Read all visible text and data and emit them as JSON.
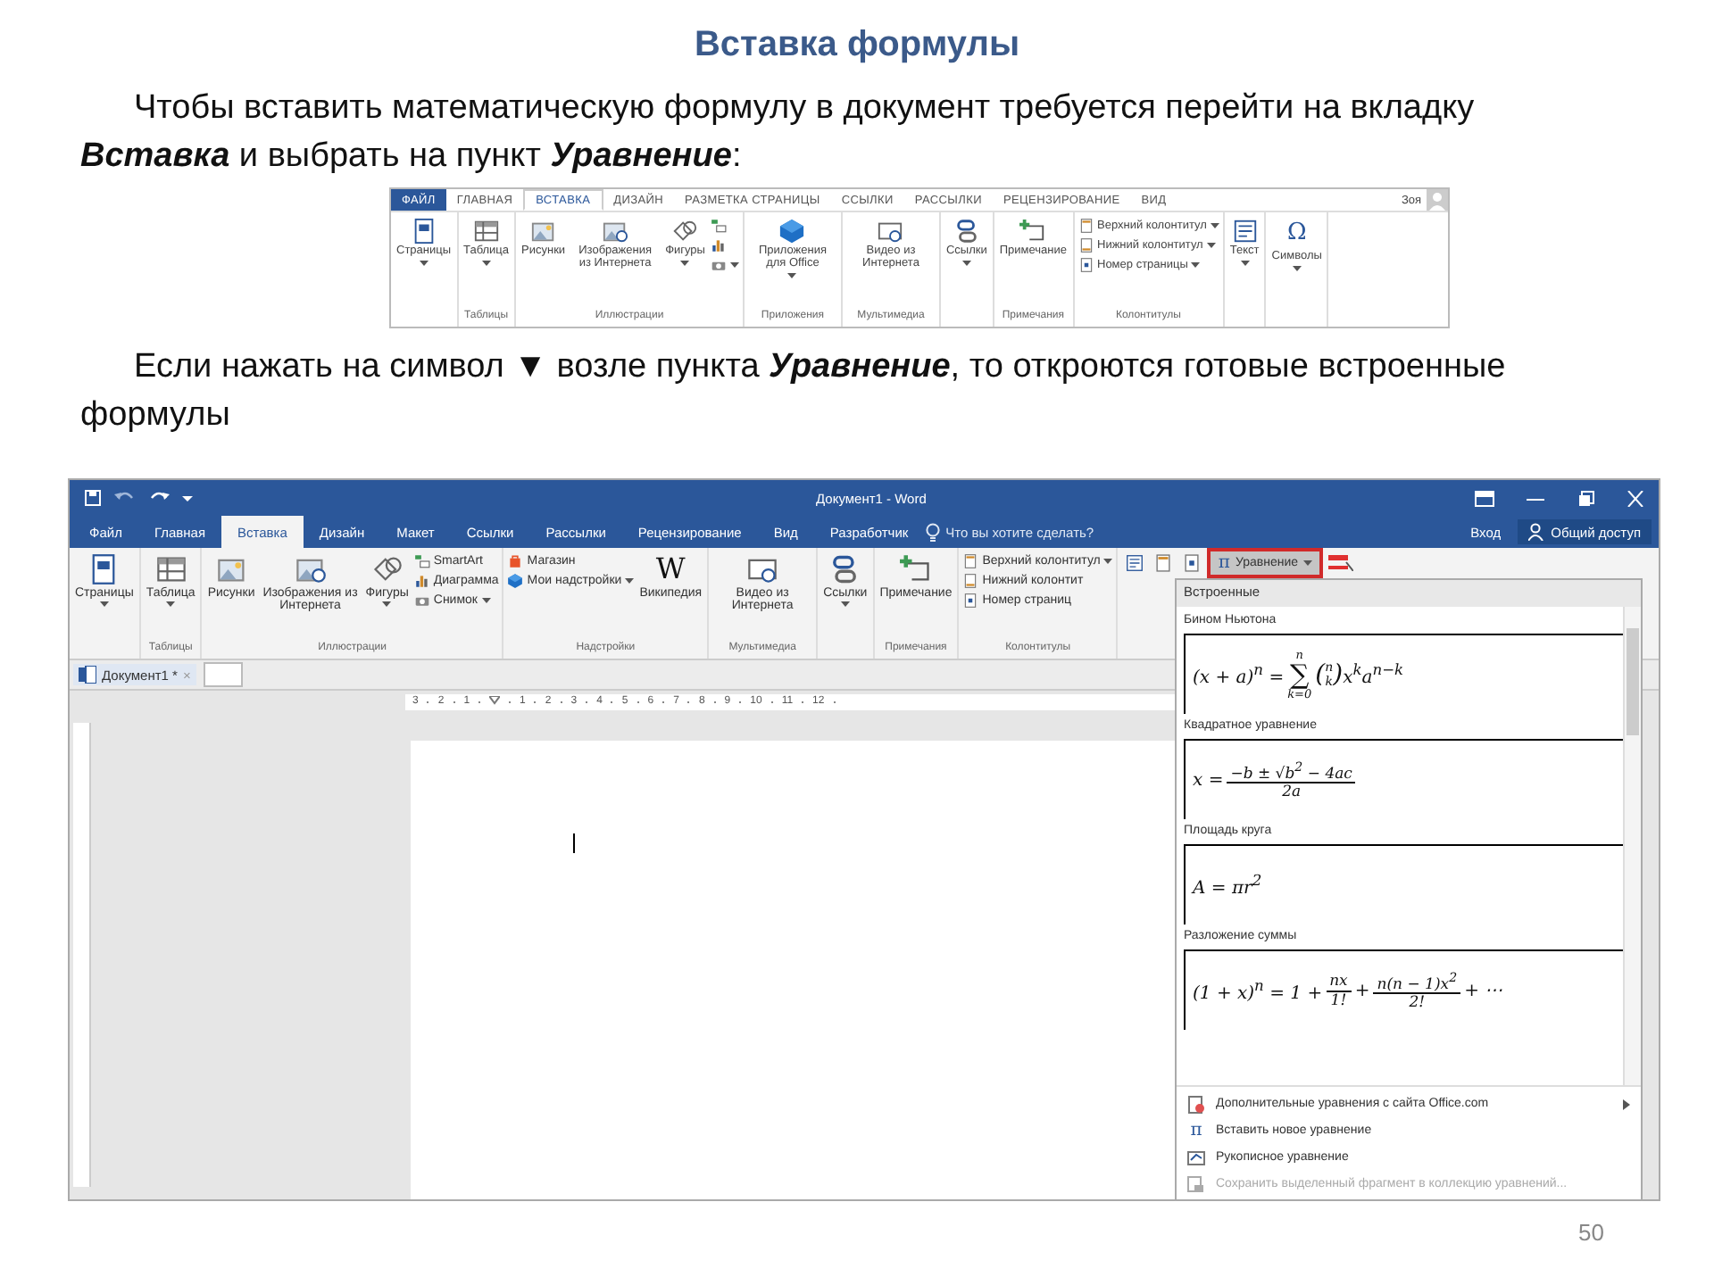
{
  "slide": {
    "title": "Вставка формулы",
    "paragraphs": [
      "Чтобы вставить математическую формулу в документ требуется перейти на вкладку **Вставка** и выбрать на пункт **Уравнение**:",
      "Если нажать на символ ▼ возле пункта **Уравнение**, то откроются готовые встроенные формулы"
    ],
    "page_number": "50"
  },
  "ribbon_screenshot": {
    "tabs": [
      {
        "label": "ФАЙЛ",
        "kind": "file",
        "selected": false
      },
      {
        "label": "ГЛАВНАЯ",
        "kind": "tab",
        "selected": false
      },
      {
        "label": "ВСТАВКА",
        "kind": "tab",
        "selected": true
      },
      {
        "label": "ДИЗАЙН",
        "kind": "tab",
        "selected": false
      },
      {
        "label": "РАЗМЕТКА СТРАНИЦЫ",
        "kind": "tab",
        "selected": false
      },
      {
        "label": "ССЫЛКИ",
        "kind": "tab",
        "selected": false
      },
      {
        "label": "РАССЫЛКИ",
        "kind": "tab",
        "selected": false
      },
      {
        "label": "РЕЦЕНЗИРОВАНИЕ",
        "kind": "tab",
        "selected": false
      },
      {
        "label": "ВИД",
        "kind": "tab",
        "selected": false
      }
    ],
    "user": "Зоя",
    "groups": [
      {
        "buttons": [
          {
            "label": "Страницы",
            "kind": "large",
            "menu": true
          }
        ]
      },
      {
        "label": "Таблицы",
        "buttons": [
          {
            "label": "Таблица",
            "kind": "large",
            "menu": true
          }
        ]
      },
      {
        "label": "Иллюстрации",
        "buttons": [
          {
            "label": "Рисунки",
            "kind": "large",
            "menu": false
          },
          {
            "label": "Изображения из Интернета",
            "kind": "large",
            "menu": false
          },
          {
            "label": "Фигуры",
            "kind": "large",
            "menu": true
          },
          {
            "kind": "icon",
            "menu": false
          },
          {
            "kind": "icon",
            "menu": false
          },
          {
            "kind": "icon",
            "menu": true
          }
        ]
      },
      {
        "label": "Приложения",
        "buttons": [
          {
            "label": "Приложения для Office",
            "kind": "large",
            "menu": true
          }
        ]
      },
      {
        "label": "Мультимедиа",
        "buttons": [
          {
            "label": "Видео из Интернета",
            "kind": "large",
            "menu": false
          }
        ]
      },
      {
        "buttons": [
          {
            "label": "Ссылки",
            "kind": "large",
            "menu": true
          }
        ]
      },
      {
        "label": "Примечания",
        "buttons": [
          {
            "label": "Примечание",
            "kind": "large",
            "menu": false
          }
        ]
      },
      {
        "label": "Колонтитулы",
        "buttons": [
          {
            "label": "Верхний колонтитул",
            "kind": "small",
            "menu": true
          },
          {
            "label": "Нижний колонтитул",
            "kind": "small",
            "menu": true
          },
          {
            "label": "Номер страницы",
            "kind": "small",
            "menu": true
          }
        ]
      },
      {
        "buttons": [
          {
            "label": "Текст",
            "kind": "large",
            "menu": true
          }
        ]
      },
      {
        "buttons": [
          {
            "label": "Символы",
            "kind": "large",
            "menu": true,
            "glyph": "Ω"
          }
        ]
      }
    ]
  },
  "word_window": {
    "title": "Документ1 - Word",
    "tabs": [
      {
        "label": "Файл",
        "selected": false
      },
      {
        "label": "Главная",
        "selected": false
      },
      {
        "label": "Вставка",
        "selected": true
      },
      {
        "label": "Дизайн",
        "selected": false
      },
      {
        "label": "Макет",
        "selected": false
      },
      {
        "label": "Ссылки",
        "selected": false
      },
      {
        "label": "Рассылки",
        "selected": false
      },
      {
        "label": "Рецензирование",
        "selected": false
      },
      {
        "label": "Вид",
        "selected": false
      },
      {
        "label": "Разработчик",
        "selected": false
      }
    ],
    "tell_me": "Что вы хотите сделать?",
    "sign_in": "Вход",
    "share": "Общий доступ",
    "groups": [
      {
        "buttons": [
          {
            "label": "Страницы",
            "kind": "large",
            "menu": true
          }
        ]
      },
      {
        "label": "Таблицы",
        "buttons": [
          {
            "label": "Таблица",
            "kind": "large",
            "menu": true
          }
        ]
      },
      {
        "label": "Иллюстрации",
        "buttons": [
          {
            "label": "Рисунки",
            "kind": "large",
            "menu": false
          },
          {
            "label": "Изображения из Интернета",
            "kind": "large",
            "menu": false
          },
          {
            "label": "Фигуры",
            "kind": "large",
            "menu": true
          },
          {
            "label": "SmartArt",
            "kind": "small",
            "menu": false
          },
          {
            "label": "Диаграмма",
            "kind": "small",
            "menu": false
          },
          {
            "label": "Снимок",
            "kind": "small",
            "menu": true
          }
        ]
      },
      {
        "label": "Надстройки",
        "buttons": [
          {
            "label": "Магазин",
            "kind": "small",
            "menu": false
          },
          {
            "label": "Мои надстройки",
            "kind": "small",
            "menu": true
          },
          {
            "label": "Википедия",
            "kind": "large",
            "menu": false,
            "glyph": "W"
          }
        ]
      },
      {
        "label": "Мультимедиа",
        "buttons": [
          {
            "label": "Видео из Интернета",
            "kind": "large",
            "menu": false
          }
        ]
      },
      {
        "buttons": [
          {
            "label": "Ссылки",
            "kind": "large",
            "menu": true
          }
        ]
      },
      {
        "label": "Примечания",
        "buttons": [
          {
            "label": "Примечание",
            "kind": "large",
            "menu": false
          }
        ]
      },
      {
        "label": "Колонтитулы",
        "buttons": [
          {
            "label": "Верхний колонтитул",
            "kind": "small",
            "menu": true
          },
          {
            "label": "Нижний колонтит",
            "kind": "small",
            "menu": false
          },
          {
            "label": "Номер страниц",
            "kind": "small",
            "menu": false
          }
        ]
      }
    ],
    "equation_button": {
      "label": "Уравнение",
      "glyph": "π",
      "selected": true
    },
    "document_tab": {
      "label": "Документ1 *",
      "close": "×"
    },
    "ruler": [
      "3",
      "2",
      "1",
      "1",
      "2",
      "3",
      "4",
      "5",
      "6",
      "7",
      "8",
      "9",
      "10",
      "11",
      "12"
    ],
    "equation_gallery": {
      "header": "Встроенные",
      "items": [
        {
          "label": "Бином Ньютона",
          "parts": [
            {
              "kind": "text",
              "text": "(x + a)$^{n}$ = "
            },
            {
              "kind": "sum",
              "symbol": "∑",
              "upper": "n",
              "lower": "k=0"
            },
            {
              "kind": "binom",
              "open": "(",
              "top": "n",
              "bottom": "k",
              "close": ")"
            },
            {
              "kind": "text",
              "text": "x$^{k}$a$^{n−k}$"
            }
          ]
        },
        {
          "label": "Квадратное уравнение",
          "parts": [
            {
              "kind": "text",
              "text": "x = "
            },
            {
              "kind": "frac",
              "num": "−b ± √b$^{2}$ − 4ac",
              "den": "2a"
            }
          ]
        },
        {
          "label": "Площадь круга",
          "parts": [
            {
              "kind": "text",
              "text": "A = πr$^{2}$"
            }
          ]
        },
        {
          "label": "Разложение суммы",
          "parts": [
            {
              "kind": "text",
              "text": "(1 + x)$^{n}$ = 1 + "
            },
            {
              "kind": "frac",
              "num": "nx",
              "den": "1!"
            },
            {
              "kind": "text",
              "text": " + "
            },
            {
              "kind": "frac",
              "num": "n(n − 1)x$^{2}$",
              "den": "2!"
            },
            {
              "kind": "text",
              "text": " + ⋯"
            }
          ]
        }
      ],
      "menu": [
        {
          "label": "Дополнительные уравнения с сайта Office.com",
          "disabled": false,
          "submenu": true
        },
        {
          "label": "Вставить новое уравнение",
          "disabled": false,
          "submenu": false,
          "glyph": "π"
        },
        {
          "label": "Рукописное уравнение",
          "disabled": false,
          "submenu": false
        },
        {
          "label": "Сохранить выделенный фрагмент в коллекцию уравнений...",
          "disabled": true,
          "submenu": false
        }
      ]
    }
  }
}
